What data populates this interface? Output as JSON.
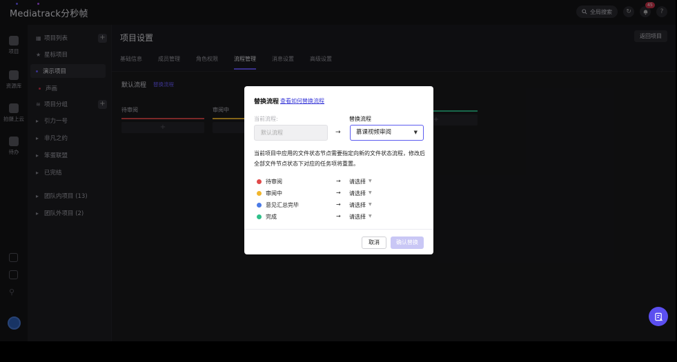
{
  "app": {
    "logo": "Mediatrack分秒帧"
  },
  "topbar": {
    "search_label": "全局搜索",
    "notification_count": "45",
    "help_label": "?"
  },
  "rail": {
    "items": [
      {
        "label": "项目"
      },
      {
        "label": "资源库"
      },
      {
        "label": "拍摄上云"
      },
      {
        "label": "待办"
      }
    ]
  },
  "sidebar": {
    "project_list": "项目列表",
    "starred": "星标项目",
    "demo_project": "演示项目",
    "voice_project": "声画",
    "group_header": "项目分组",
    "groups": [
      "引力一号",
      "非凡之约",
      "笨蛋联盟",
      "已完结"
    ],
    "team_in": "团队内项目 (13)",
    "team_out": "团队外项目 (2)"
  },
  "main": {
    "title": "项目设置",
    "back_button": "返回项目",
    "tabs": [
      "基础信息",
      "成员管理",
      "角色权限",
      "流程管理",
      "消息设置",
      "高级设置"
    ],
    "active_tab": 3,
    "flow_title": "默认流程",
    "flow_switch": "替换流程",
    "columns": [
      "待审阅",
      "审阅中"
    ]
  },
  "modal": {
    "title": "替换流程",
    "how_link": "查看如何替换流程",
    "current_label": "当前流程:",
    "current_value": "默认流程",
    "new_label": "替换流程",
    "new_value": "慕课视频审阅",
    "arrow": "→",
    "description": "当前项目中应用的文件状态节点需要指定向新的文件状态流程，修改后全部文件节点状态下对应的任务项将重置。",
    "mappings": [
      {
        "status": "待审阅",
        "color": "#e04a4a",
        "target": "请选择"
      },
      {
        "status": "审阅中",
        "color": "#f1b62d",
        "target": "请选择"
      },
      {
        "status": "意见汇总完毕",
        "color": "#4b7be6",
        "target": "请选择"
      },
      {
        "status": "完成",
        "color": "#2fc08a",
        "target": "请选择"
      }
    ],
    "cancel": "取消",
    "confirm": "确认替换"
  },
  "colors": {
    "accent": "#6b5cff",
    "confirm_disabled": "#c9c7f5"
  }
}
